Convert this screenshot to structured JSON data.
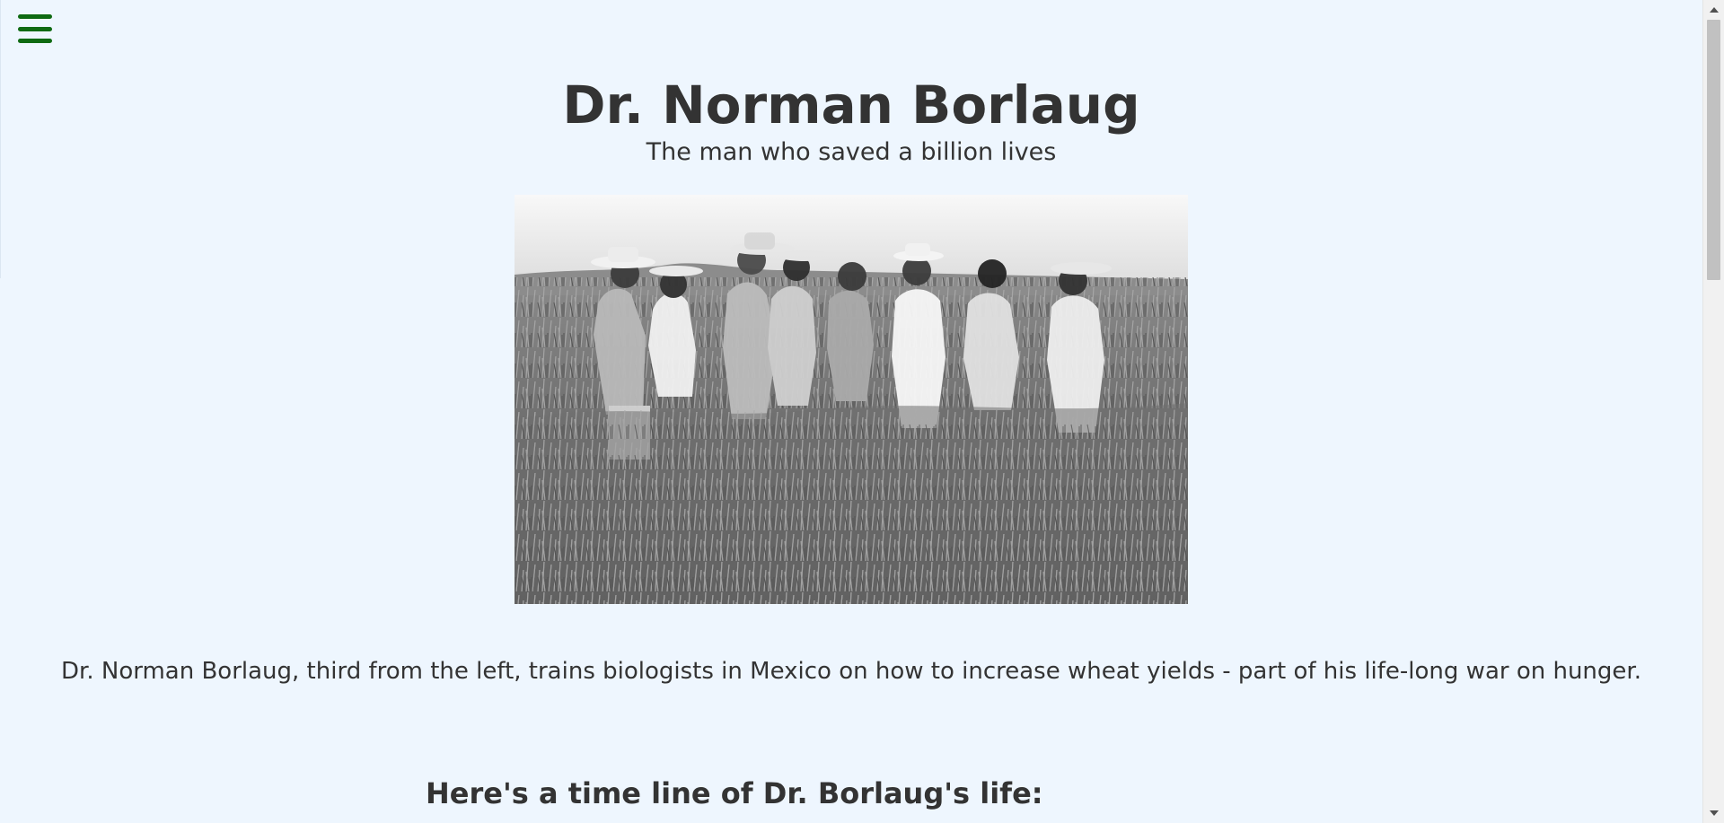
{
  "header": {
    "menu_icon": "hamburger-menu-icon",
    "menu_color": "#0f6a12"
  },
  "main": {
    "title": "Dr. Norman Borlaug",
    "subtitle": "The man who saved a billion lives",
    "caption": "Dr. Norman Borlaug, third from the left, trains biologists in Mexico on how to increase wheat yields - part of his life-long war on hunger.",
    "timeline_heading": "Here's a time line of Dr. Borlaug's life:"
  },
  "colors": {
    "background": "#eef6fe",
    "text": "#333333"
  }
}
